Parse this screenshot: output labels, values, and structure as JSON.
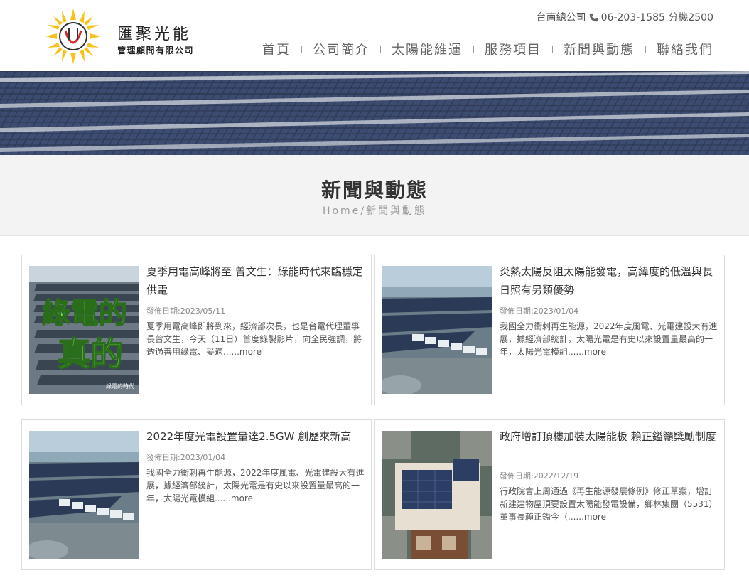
{
  "brand": {
    "name": "匯聚光能",
    "subname": "管理顧問有限公司",
    "accent_yellow": "#f7c21b",
    "accent_red": "#d12f2f"
  },
  "contact": {
    "office": "台南總公司",
    "phone_icon": "phone-icon",
    "phone": "06-203-1585 分機2500"
  },
  "nav": {
    "items": [
      "首頁",
      "公司簡介",
      "太陽能維運",
      "服務項目",
      "新聞與動態",
      "聯絡我們"
    ]
  },
  "page": {
    "title": "新聞與動態",
    "breadcrumb_home": "Home",
    "breadcrumb_sep": "/",
    "breadcrumb_current": "新聞與動態"
  },
  "news": [
    {
      "title": "夏季用電高峰將至 曾文生：綠能時代來臨穩定供電",
      "date": "發佈日期:2023/05/11",
      "excerpt": "夏季用電高峰即將到來，經濟部次長，也是台電代理董事長曾文生，今天（11日）首度錄製影片，向全民強調，將透過善用綠電、妥適......",
      "more": "more",
      "thumb_text_1": "綠電的",
      "thumb_text_2": "真的",
      "thumb_caption": "綠電的時代"
    },
    {
      "title": "炎熱太陽反阻太陽能發電，高緯度的低溫與長日照有另類優勢",
      "date": "發佈日期:2023/01/04",
      "excerpt": "我國全力衝刺再生能源，2022年度風電、光電建設大有進展，據經濟部統計，太陽光電是有史以來設置量最高的一年，太陽光電模組......",
      "more": "more"
    },
    {
      "title": "2022年度光電設置量達2.5GW 創歷來新高",
      "date": "發佈日期:2023/01/04",
      "excerpt": "我國全力衝刺再生能源，2022年度風電、光電建設大有進展，據經濟部統計，太陽光電是有史以來設置量最高的一年，太陽光電模組......",
      "more": "more"
    },
    {
      "title": "政府增訂頂樓加裝太陽能板 賴正鎰籲槳勵制度",
      "date": "發佈日期:2022/12/19",
      "excerpt": "行政院會上周通過《再生能源發展條例》修正草案，增訂新建建物屋頂要設置太陽能發電設備，鄉林集團（5531）董事長賴正鎰今（......",
      "more": "more"
    }
  ]
}
